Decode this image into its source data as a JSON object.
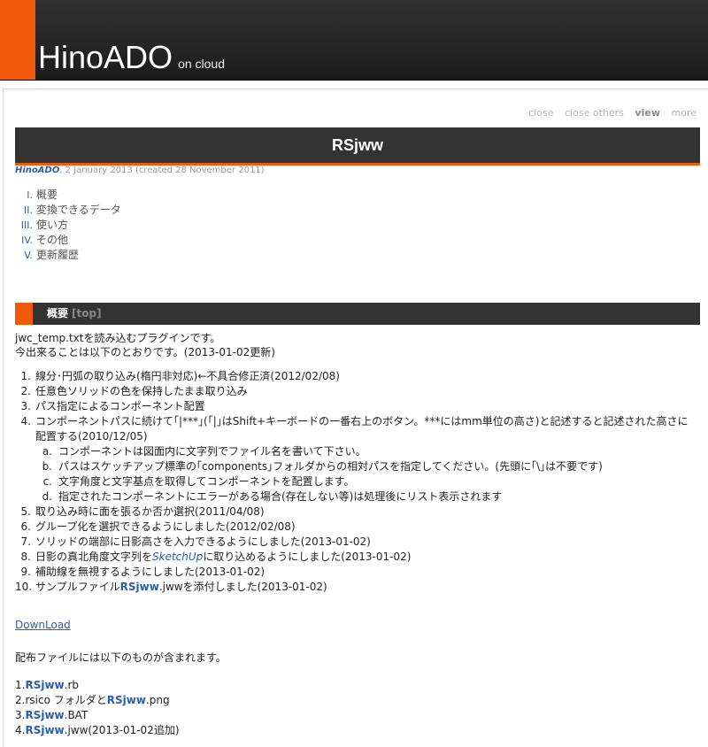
{
  "site": {
    "title": "HinoADO",
    "subtitle": "on cloud"
  },
  "actions": {
    "close": "close",
    "close_others": "close others",
    "view": "view",
    "more": "more"
  },
  "page": {
    "title": "RSjww",
    "author": "HinoADO",
    "meta": ", 2 January 2013 (created 28 November 2011)"
  },
  "toc": [
    {
      "num": "I.",
      "label": "概要"
    },
    {
      "num": "II.",
      "label": "変換できるデータ"
    },
    {
      "num": "III.",
      "label": "使い方"
    },
    {
      "num": "IV.",
      "label": "その他"
    },
    {
      "num": "V.",
      "label": "更新履歴"
    }
  ],
  "section": {
    "title": "概要",
    "top_link": "[top]"
  },
  "intro": {
    "line1": "jwc_temp.txtを読み込むプラグインです。",
    "line2": "今出来ることは以下のとおりです。(2013-01-02更新)"
  },
  "features": {
    "i1": {
      "num": "1.",
      "text": "線分･円弧の取り込み(楕円非対応)←不具合修正済(2012/02/08)"
    },
    "i2": {
      "num": "2.",
      "text": "任意色ソリッドの色を保持したまま取り込み"
    },
    "i3": {
      "num": "3.",
      "text": "パス指定によるコンポーネント配置"
    },
    "i4": {
      "num": "4.",
      "text": "コンポーネントパスに続けて｢|***｣(｢|｣はShift+キーボードの一番右上のボタン。***にはmm単位の高さ)と記述すると記述された高さに配置する(2010/12/05)"
    },
    "i4a": {
      "num": "a.",
      "text": "コンポーネントは図面内に文字列でファイル名を書いて下さい。"
    },
    "i4b": {
      "num": "b.",
      "text": "パスはスケッチアップ標準の｢components｣フォルダからの相対パスを指定してください。(先頭に｢\\｣は不要です)"
    },
    "i4c": {
      "num": "c.",
      "text": "文字角度と文字基点を取得してコンポーネントを配置します。"
    },
    "i4d": {
      "num": "d.",
      "text": "指定されたコンポーネントにエラーがある場合(存在しない等)は処理後にリスト表示されます"
    },
    "i5": {
      "num": "5.",
      "text": "取り込み時に面を張るか否か選択(2011/04/08)"
    },
    "i6": {
      "num": "6.",
      "text": "グループ化を選択できるようにしました(2012/02/08)"
    },
    "i7": {
      "num": "7.",
      "text": "ソリッドの端部に日影高さを入力できるようにしました(2013-01-02)"
    },
    "i8": {
      "num": "8.",
      "pre": "日影の真北角度文字列を",
      "link": "SketchUp",
      "post": "に取り込めるようにしました(2013-01-02)"
    },
    "i9": {
      "num": "9.",
      "text": "補助線を無視するようにしました(2013-01-02)"
    },
    "i10": {
      "num": "10.",
      "pre": "サンプルファイル",
      "kw": "RSjww",
      "post": ".jwwを添付しました(2013-01-02)"
    }
  },
  "download": "DownLoad",
  "dist_intro": "配布ファイルには以下のものが含まれます。",
  "files": {
    "f1": {
      "pre": "1.",
      "kw": "RSjww",
      "post": ".rb"
    },
    "f2": {
      "pre": "2.rsico フォルダと",
      "kw": "RSjww",
      "post": ".png"
    },
    "f3": {
      "pre": "3.",
      "kw": "RSjww",
      "post": ".BAT"
    },
    "f4": {
      "pre": "4.",
      "kw": "RSjww",
      "post": ".jww(2013-01-02追加)"
    }
  },
  "colors": {
    "accent": "#f05a0a",
    "link": "#2a5ea8",
    "header_bg": "#2b2b2b"
  }
}
